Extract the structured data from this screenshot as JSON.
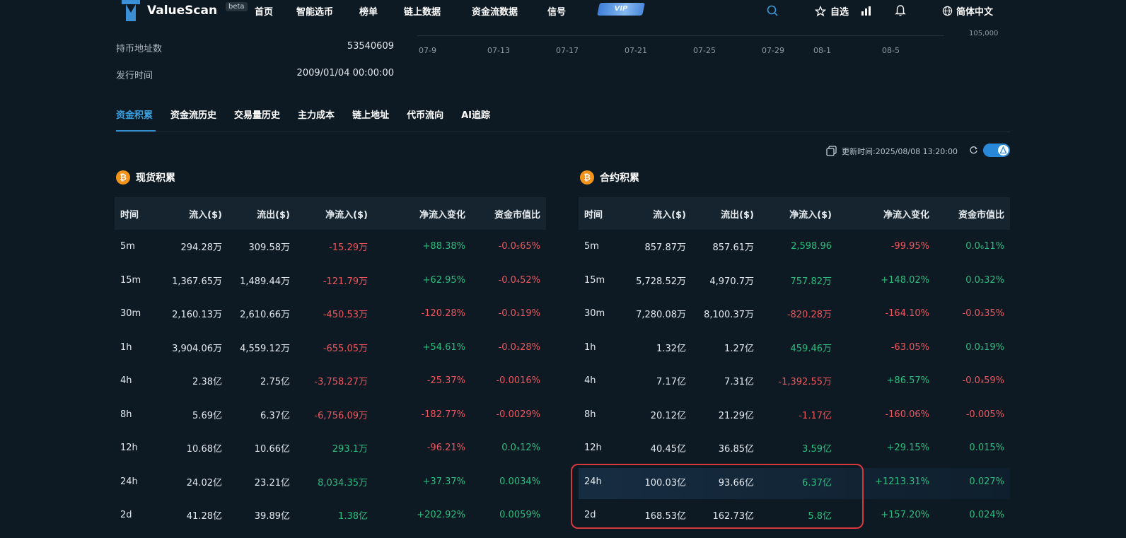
{
  "nav": {
    "brand": "ValueScan",
    "beta": "beta",
    "items": [
      "首页",
      "智能选币",
      "榜单",
      "链上数据",
      "资金流数据",
      "信号"
    ],
    "vip": "VIP",
    "favorites": "自选",
    "language": "简体中文"
  },
  "info": {
    "holders_label": "持币地址数",
    "holders_value": "53540609",
    "issue_label": "发行时间",
    "issue_value": "2009/01/04 00:00:00"
  },
  "mini_chart": {
    "x_ticks": [
      "07-9",
      "07-13",
      "07-17",
      "07-21",
      "07-25",
      "07-29",
      "08-1",
      "08-5"
    ],
    "y_tick": "105,000"
  },
  "tabs": [
    "资金积累",
    "资金流历史",
    "交易量历史",
    "主力成本",
    "链上地址",
    "代币流向",
    "AI追踪"
  ],
  "update_text": "更新时间:2025/08/08 13:20:00",
  "spot": {
    "title": "现货积累",
    "headers": [
      "时间",
      "流入($)",
      "流出($)",
      "净流入($)",
      "净流入变化",
      "资金市值比"
    ],
    "rows": [
      [
        "5m",
        "294.28万",
        "309.58万",
        "-15.29万",
        "+88.38%",
        "-0.0₅65%"
      ],
      [
        "15m",
        "1,367.65万",
        "1,489.44万",
        "-121.79万",
        "+62.95%",
        "-0.0₄52%"
      ],
      [
        "30m",
        "2,160.13万",
        "2,610.66万",
        "-450.53万",
        "-120.28%",
        "-0.0₃19%"
      ],
      [
        "1h",
        "3,904.06万",
        "4,559.12万",
        "-655.05万",
        "+54.61%",
        "-0.0₃28%"
      ],
      [
        "4h",
        "2.38亿",
        "2.75亿",
        "-3,758.27万",
        "-25.37%",
        "-0.0016%"
      ],
      [
        "8h",
        "5.69亿",
        "6.37亿",
        "-6,756.09万",
        "-182.77%",
        "-0.0029%"
      ],
      [
        "12h",
        "10.68亿",
        "10.66亿",
        "293.1万",
        "-96.21%",
        "0.0₃12%"
      ],
      [
        "24h",
        "24.02亿",
        "23.21亿",
        "8,034.35万",
        "+37.37%",
        "0.0034%"
      ],
      [
        "2d",
        "41.28亿",
        "39.89亿",
        "1.38亿",
        "+202.92%",
        "0.0059%"
      ]
    ],
    "colors": [
      [
        "",
        "",
        "",
        "neg",
        "pos",
        "neg"
      ],
      [
        "",
        "",
        "",
        "neg",
        "pos",
        "neg"
      ],
      [
        "",
        "",
        "",
        "neg",
        "neg",
        "neg"
      ],
      [
        "",
        "",
        "",
        "neg",
        "pos",
        "neg"
      ],
      [
        "",
        "",
        "",
        "neg",
        "neg",
        "neg"
      ],
      [
        "",
        "",
        "",
        "neg",
        "neg",
        "neg"
      ],
      [
        "",
        "",
        "",
        "pos",
        "neg",
        "pos"
      ],
      [
        "",
        "",
        "",
        "pos",
        "pos",
        "pos"
      ],
      [
        "",
        "",
        "",
        "pos",
        "pos",
        "pos"
      ]
    ]
  },
  "futures": {
    "title": "合约积累",
    "headers": [
      "时间",
      "流入($)",
      "流出($)",
      "净流入($)",
      "净流入变化",
      "资金市值比"
    ],
    "rows": [
      [
        "5m",
        "857.87万",
        "857.61万",
        "2,598.96",
        "-99.95%",
        "0.0₆11%"
      ],
      [
        "15m",
        "5,728.52万",
        "4,970.7万",
        "757.82万",
        "+148.02%",
        "0.0₃32%"
      ],
      [
        "30m",
        "7,280.08万",
        "8,100.37万",
        "-820.28万",
        "-164.10%",
        "-0.0₃35%"
      ],
      [
        "1h",
        "1.32亿",
        "1.27亿",
        "459.46万",
        "-63.05%",
        "0.0₃19%"
      ],
      [
        "4h",
        "7.17亿",
        "7.31亿",
        "-1,392.55万",
        "+86.57%",
        "-0.0₃59%"
      ],
      [
        "8h",
        "20.12亿",
        "21.29亿",
        "-1.17亿",
        "-160.06%",
        "-0.005%"
      ],
      [
        "12h",
        "40.45亿",
        "36.85亿",
        "3.59亿",
        "+29.15%",
        "0.015%"
      ],
      [
        "24h",
        "100.03亿",
        "93.66亿",
        "6.37亿",
        "+1213.31%",
        "0.027%"
      ],
      [
        "2d",
        "168.53亿",
        "162.73亿",
        "5.8亿",
        "+157.20%",
        "0.024%"
      ]
    ],
    "colors": [
      [
        "",
        "",
        "",
        "pos",
        "neg",
        "pos"
      ],
      [
        "",
        "",
        "",
        "pos",
        "pos",
        "pos"
      ],
      [
        "",
        "",
        "",
        "neg",
        "neg",
        "neg"
      ],
      [
        "",
        "",
        "",
        "pos",
        "neg",
        "pos"
      ],
      [
        "",
        "",
        "",
        "neg",
        "pos",
        "neg"
      ],
      [
        "",
        "",
        "",
        "neg",
        "neg",
        "neg"
      ],
      [
        "",
        "",
        "",
        "pos",
        "pos",
        "pos"
      ],
      [
        "",
        "",
        "",
        "pos",
        "pos",
        "pos"
      ],
      [
        "",
        "",
        "",
        "pos",
        "pos",
        "pos"
      ]
    ]
  },
  "theme": {
    "positive": "#2bbd7e",
    "negative": "#f0555b",
    "accent": "#2f8fd0",
    "highlight_border": "#d8383c"
  }
}
